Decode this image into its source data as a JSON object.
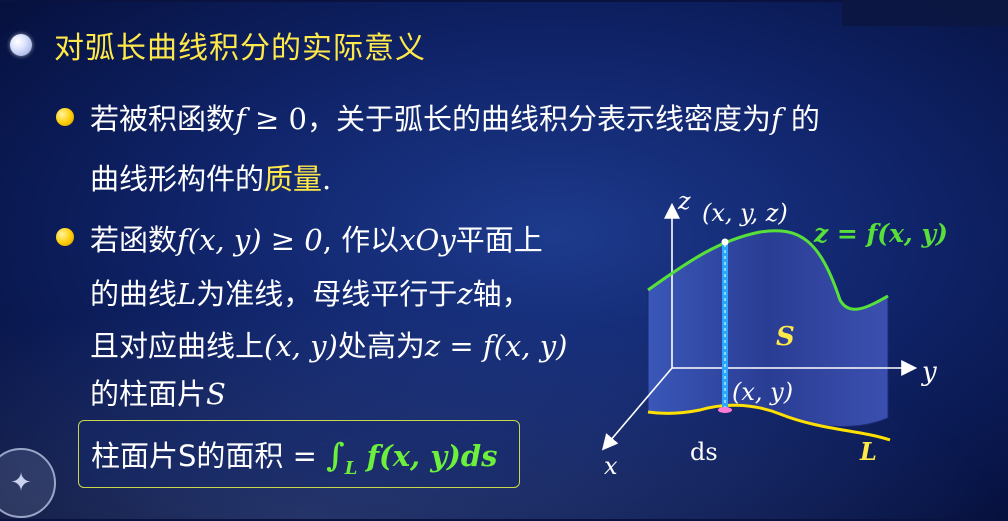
{
  "title": "对弧长曲线积分的实际意义",
  "bullet1": {
    "line1_a": "若被积函数",
    "line1_f": "f",
    "line1_geq": " ≥ 0",
    "line1_b": "，关于弧长的曲线积分表示线密度为",
    "line1_f2": "f",
    "line1_c": " 的",
    "line2_a": "曲线形构件的",
    "line2_highlight": "质量",
    "line2_end": "."
  },
  "bullet2": {
    "l1_a": "若函数",
    "l1_math": "f(x, y) ≥ 0",
    "l1_b": ", 作以",
    "l1_plane": "xOy",
    "l1_c": "平面上",
    "l2_a": "的曲线",
    "l2_L": "L",
    "l2_b": "为准线，母线平行于",
    "l2_z": "z",
    "l2_c": "轴，",
    "l3_a": "且对应曲线上",
    "l3_xy": "(x, y)",
    "l3_b": "处高为",
    "l3_formula": "z = f(x, y)",
    "l4_a": "的柱面片",
    "l4_S": "S"
  },
  "box": {
    "label": "柱面片S的面积 =",
    "integral": "∫",
    "sub": "L",
    "integrand": "f(x, y)ds"
  },
  "diagram": {
    "z_axis": "z",
    "point_top": "(x, y, z)",
    "surface_eq": "z = f(x, y)",
    "S": "S",
    "y_axis": "y",
    "point_base": "(x, y)",
    "x_axis": "x",
    "ds": "ds",
    "L": "L"
  },
  "colors": {
    "title": "#ffe84a",
    "highlight": "#ffe84a",
    "surface_curve": "#58e03a",
    "base_curve": "#ffe000",
    "background": "#10246a"
  },
  "icons": [
    "title-bullet-icon",
    "bullet-icon",
    "university-seal-icon"
  ]
}
